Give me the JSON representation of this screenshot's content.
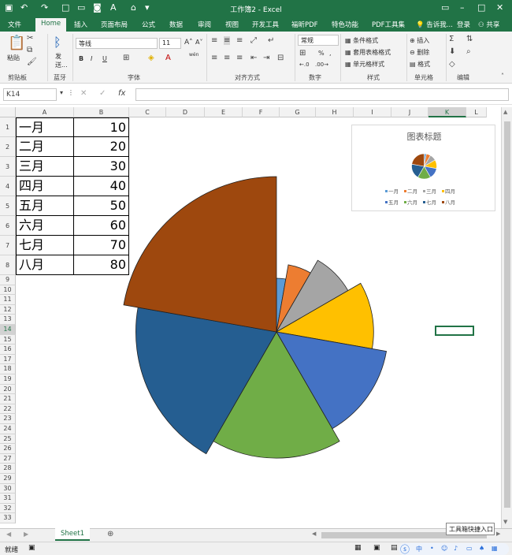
{
  "window": {
    "title": "工作簿2 - Excel",
    "quick_access": [
      "save-icon",
      "undo-icon",
      "redo-icon",
      "new-icon",
      "open-icon",
      "camera-icon",
      "font-color-icon",
      "format-painter-icon",
      "customize-icon"
    ]
  },
  "tabs": [
    "文件",
    "Home",
    "插入",
    "页面布局",
    "公式",
    "数据",
    "审阅",
    "视图",
    "开发工具",
    "福昕PDF",
    "特色功能",
    "PDF工具集"
  ],
  "active_tab": "Home",
  "tell_me": "告诉我...",
  "login": "登录",
  "share": "共享",
  "ribbon": {
    "groups": [
      "剪贴板",
      "蓝牙",
      "字体",
      "对齐方式",
      "数字",
      "样式",
      "单元格",
      "编辑"
    ],
    "paste": "粘贴",
    "send": "发\n送...",
    "font_name": "等线",
    "font_size": "11",
    "number_format": "常规",
    "styles": [
      "条件格式",
      "套用表格格式",
      "单元格样式"
    ],
    "cells": [
      "插入",
      "删除",
      "格式"
    ],
    "wen": "wén",
    "bold": "B",
    "italic": "I",
    "underline": "U"
  },
  "formula_bar": {
    "name_box": "K14",
    "formula": ""
  },
  "columns": [
    "A",
    "B",
    "C",
    "D",
    "E",
    "F",
    "G",
    "H",
    "I",
    "J",
    "K",
    "L"
  ],
  "rows": [
    "1",
    "2",
    "3",
    "4",
    "5",
    "6",
    "7",
    "8",
    "9",
    "10",
    "11",
    "12",
    "13",
    "14",
    "15",
    "16",
    "17",
    "18",
    "19",
    "20",
    "21",
    "22",
    "23",
    "24",
    "25",
    "26",
    "27",
    "28",
    "29",
    "30",
    "31",
    "32",
    "33"
  ],
  "cells": [
    {
      "a": "一月",
      "b": "10"
    },
    {
      "a": "二月",
      "b": "20"
    },
    {
      "a": "三月",
      "b": "30"
    },
    {
      "a": "四月",
      "b": "40"
    },
    {
      "a": "五月",
      "b": "50"
    },
    {
      "a": "六月",
      "b": "60"
    },
    {
      "a": "七月",
      "b": "70"
    },
    {
      "a": "八月",
      "b": "80"
    }
  ],
  "sheet_tabs": [
    "Sheet1"
  ],
  "status": {
    "ready": "就绪"
  },
  "taskbar_popup": "工具箱快捷入口",
  "colors": {
    "excel_green": "#217346",
    "series": [
      "#5B9BD5",
      "#ED7D31",
      "#A5A5A5",
      "#FFC000",
      "#4472C4",
      "#70AD47",
      "#255E91",
      "#9E480E"
    ]
  },
  "chart_data": {
    "type": "pie",
    "title": "图表标题",
    "categories": [
      "一月",
      "二月",
      "三月",
      "四月",
      "五月",
      "六月",
      "七月",
      "八月"
    ],
    "values": [
      10,
      20,
      30,
      40,
      50,
      60,
      70,
      80
    ],
    "legend_position": "bottom"
  }
}
